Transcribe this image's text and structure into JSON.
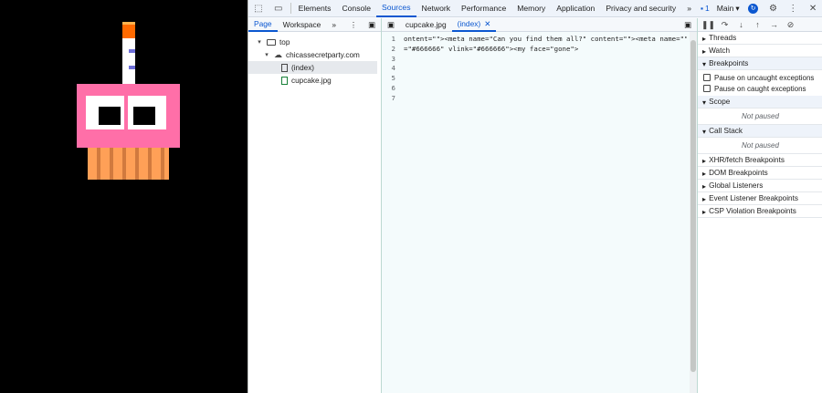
{
  "devtools": {
    "tabs": [
      "Elements",
      "Console",
      "Sources",
      "Network",
      "Performance",
      "Memory",
      "Application",
      "Privacy and security"
    ],
    "more_tabs": "»",
    "issues_count": "1",
    "context": "Main",
    "navigator": {
      "tabs": [
        "Page",
        "Workspace"
      ],
      "more": "»",
      "tree": [
        "top",
        "chicassecretparty.com",
        "(index)",
        "cupcake.jpg"
      ]
    },
    "editor": {
      "tabs": [
        "cupcake.jpg",
        "(index)"
      ],
      "lines": [
        {
          "n": "1",
          "text": "ontent=\"\"><meta name=\"Can you find them all?\" content=\"\"><meta name=\"\""
        },
        {
          "n": "2",
          "text": "=\"#666666\" vlink=\"#666666\"><my face=\"gone\">"
        },
        {
          "n": "3",
          "text": ""
        },
        {
          "n": "4",
          "text": ""
        },
        {
          "n": "5",
          "text": ""
        },
        {
          "n": "6",
          "text": ""
        },
        {
          "n": "7",
          "text": ""
        }
      ]
    },
    "debugger": {
      "sections": {
        "threads": "Threads",
        "watch": "Watch",
        "breakpoints": "Breakpoints",
        "pause_uncaught": "Pause on uncaught exceptions",
        "pause_caught": "Pause on caught exceptions",
        "scope": "Scope",
        "scope_state": "Not paused",
        "call_stack": "Call Stack",
        "call_stack_state": "Not paused",
        "xhr": "XHR/fetch Breakpoints",
        "dom": "DOM Breakpoints",
        "listeners": "Global Listeners",
        "event_listeners": "Event Listener Breakpoints",
        "csp": "CSP Violation Breakpoints"
      }
    }
  },
  "colors": {
    "accent": "#0b57d0",
    "cupcake_frosting": "#ff6fa8",
    "cupcake_wrapper": "#ffa057",
    "flame": "#ff6a00"
  }
}
